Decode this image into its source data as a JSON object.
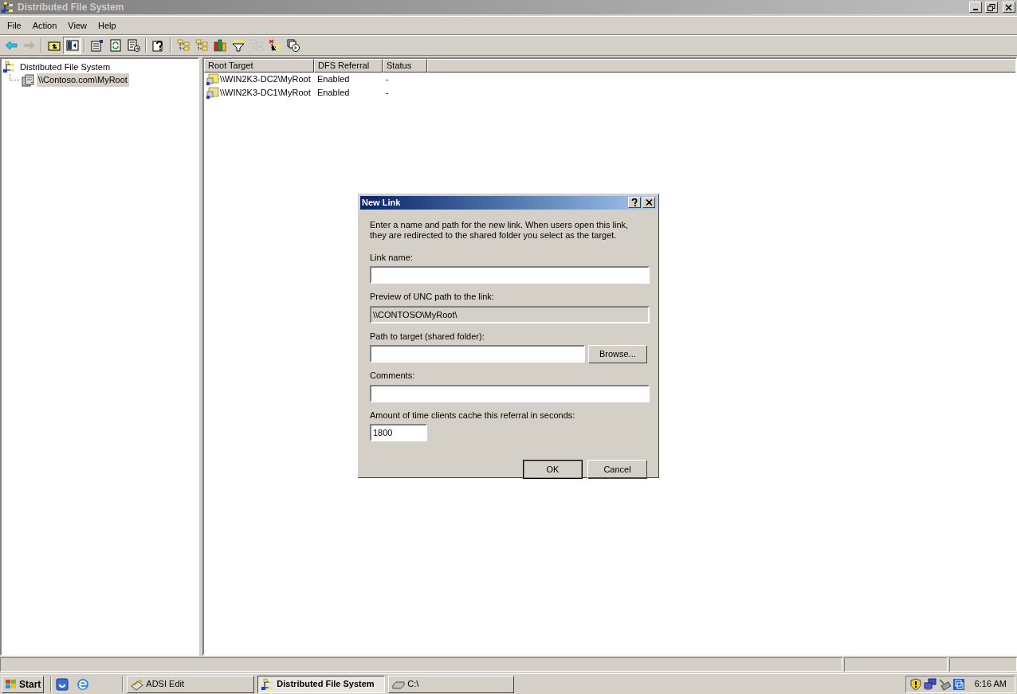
{
  "window": {
    "title": "Distributed File System"
  },
  "menu": [
    "File",
    "Action",
    "View",
    "Help"
  ],
  "toolbar": [
    {
      "kind": "back",
      "disabled": false,
      "pressed": false
    },
    {
      "kind": "forward",
      "disabled": true,
      "pressed": false
    },
    {
      "kind": "separator"
    },
    {
      "kind": "up",
      "disabled": false,
      "pressed": false
    },
    {
      "kind": "tree",
      "disabled": false,
      "pressed": true
    },
    {
      "kind": "separator"
    },
    {
      "kind": "properties",
      "disabled": false,
      "pressed": false
    },
    {
      "kind": "refresh",
      "disabled": false,
      "pressed": false
    },
    {
      "kind": "export",
      "disabled": false,
      "pressed": false
    },
    {
      "kind": "separator"
    },
    {
      "kind": "help",
      "disabled": false,
      "pressed": false
    },
    {
      "kind": "separator"
    },
    {
      "kind": "links",
      "disabled": false,
      "pressed": false
    },
    {
      "kind": "links",
      "disabled": false,
      "pressed": false
    },
    {
      "kind": "chart",
      "disabled": false,
      "pressed": false
    },
    {
      "kind": "filter",
      "disabled": false,
      "pressed": false
    },
    {
      "kind": "links",
      "disabled": true,
      "pressed": false
    },
    {
      "kind": "remove",
      "disabled": false,
      "pressed": false
    },
    {
      "kind": "run",
      "disabled": false,
      "pressed": false
    }
  ],
  "tree": {
    "label": "Distributed File System",
    "children": [
      {
        "label": "\\\\Contoso.com\\MyRoot",
        "selected": true
      }
    ]
  },
  "table": {
    "columns": [
      "Root Target",
      "DFS Referral",
      "Status"
    ],
    "rows": [
      {
        "cells": [
          "\\\\WIN2K3-DC2\\MyRoot",
          "Enabled",
          "-"
        ],
        "selected": false
      },
      {
        "cells": [
          "\\\\WIN2K3-DC1\\MyRoot",
          "Enabled",
          "-"
        ],
        "selected": false
      }
    ]
  },
  "dialog": {
    "title": "New Link",
    "intro": "Enter a name and path for the new link. When users open this link, they are redirected to the shared folder you select as the target.",
    "link_name": {
      "label": "Link name:"
    },
    "preview": {
      "label": "Preview of UNC path to the link:",
      "value": "\\\\CONTOSO\\MyRoot\\"
    },
    "target": {
      "label": "Path to target (shared folder):",
      "button": "Browse..."
    },
    "comments": {
      "label": "Comments:"
    },
    "cache": {
      "label": "Amount of time clients cache this referral in seconds:",
      "value": "1800"
    },
    "buttons": [
      "OK",
      "Cancel"
    ]
  },
  "taskbar": {
    "start": "Start",
    "tasks": [
      {
        "label": "ADSI Edit",
        "selected": false
      },
      {
        "label": "Distributed File System",
        "selected": true
      },
      {
        "label": "C:\\",
        "selected": false
      }
    ],
    "clock": "6:16 AM"
  }
}
